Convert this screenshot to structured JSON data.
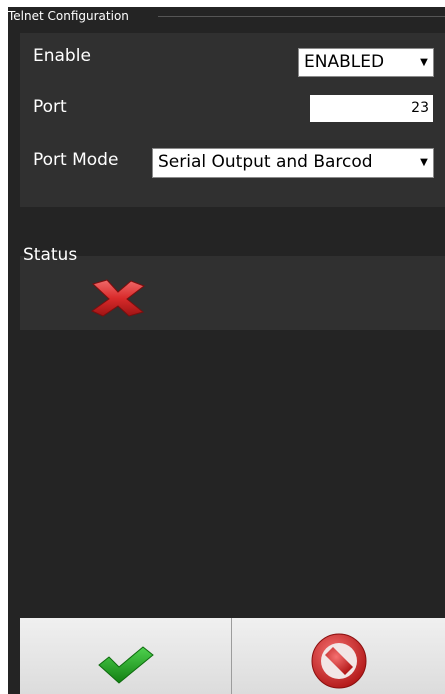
{
  "window": {
    "title": "Telnet Configuration"
  },
  "config": {
    "enable": {
      "label": "Enable",
      "value": "ENABLED"
    },
    "port": {
      "label": "Port",
      "value": "23"
    },
    "port_mode": {
      "label": "Port Mode",
      "value": "Serial Output and Barcod"
    }
  },
  "status": {
    "label": "Status",
    "icon": "red-x-icon",
    "state_color": "#d92b2b"
  },
  "footer": {
    "ok_icon": "green-checkmark-icon",
    "cancel_icon": "red-prohibited-icon",
    "ok_color": "#1fa21f",
    "cancel_color": "#d62828"
  }
}
